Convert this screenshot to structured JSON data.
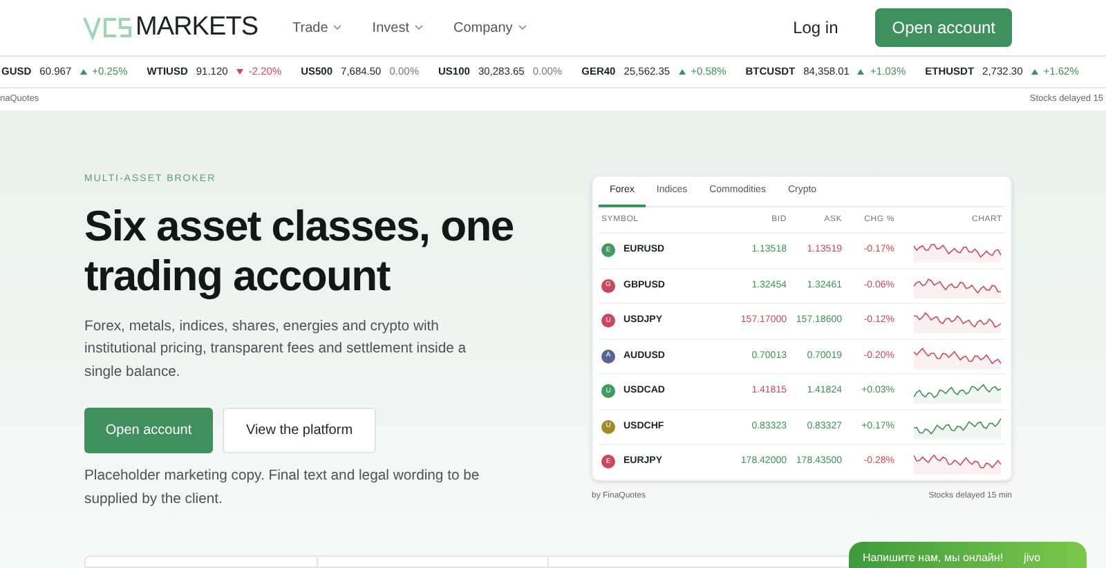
{
  "header": {
    "logo_text": "MARKETS",
    "nav": [
      {
        "label": "Trade"
      },
      {
        "label": "Invest"
      },
      {
        "label": "Company"
      }
    ],
    "login": "Log in",
    "cta": "Open account"
  },
  "ticker": [
    {
      "symbol": "GUSD",
      "price": "60.967",
      "change": "+0.25%",
      "rising": true,
      "falling": false
    },
    {
      "symbol": "WTIUSD",
      "price": "91.120",
      "change": "-2.20%",
      "rising": false,
      "falling": true
    },
    {
      "symbol": "US500",
      "price": "7,684.50",
      "change": "0.00%",
      "rising": false,
      "falling": false
    },
    {
      "symbol": "US100",
      "price": "30,283.65",
      "change": "0.00%",
      "rising": false,
      "falling": false
    },
    {
      "symbol": "GER40",
      "price": "25,562.35",
      "change": "+0.58%",
      "rising": true,
      "falling": false
    },
    {
      "symbol": "BTCUSDT",
      "price": "84,358.01",
      "change": "+1.03%",
      "rising": true,
      "falling": false
    },
    {
      "symbol": "ETHUSDT",
      "price": "2,732.30",
      "change": "+1.62%",
      "rising": true,
      "falling": false
    }
  ],
  "ticker_source": "naQuotes",
  "ticker_delay": "Stocks delayed 15",
  "hero": {
    "eyebrow": "MULTI-ASSET BROKER",
    "title": "Six asset classes, one trading account",
    "body": "Forex, metals, indices, shares, energies and crypto with institutional pricing, transparent fees and settlement inside a single balance.",
    "primary_button": "Open account",
    "secondary_button": "View the platform",
    "note": "Placeholder marketing copy. Final text and legal wording to be supplied by the client."
  },
  "quotes": {
    "tabs": [
      {
        "label": "Forex",
        "selected": true
      },
      {
        "label": "Indices",
        "selected": false
      },
      {
        "label": "Commodities",
        "selected": false
      },
      {
        "label": "Crypto",
        "selected": false
      }
    ],
    "columns": [
      "SYMBOL",
      "BID",
      "ASK",
      "CHG %",
      "CHART"
    ],
    "rows": [
      {
        "letter": "E",
        "color": "#3f9a63",
        "symbol": "EURUSD",
        "bid": "1.13518",
        "bid_up": true,
        "ask": "1.13519",
        "ask_up": false,
        "change": "-0.17%",
        "rising": false
      },
      {
        "letter": "G",
        "color": "#c9485f",
        "symbol": "GBPUSD",
        "bid": "1.32454",
        "bid_up": true,
        "ask": "1.32461",
        "ask_up": true,
        "change": "-0.06%",
        "rising": false
      },
      {
        "letter": "U",
        "color": "#c9485f",
        "symbol": "USDJPY",
        "bid": "157.17000",
        "bid_up": false,
        "ask": "157.18600",
        "ask_up": true,
        "change": "-0.12%",
        "rising": false
      },
      {
        "letter": "A",
        "color": "#56648f",
        "symbol": "AUDUSD",
        "bid": "0.70013",
        "bid_up": true,
        "ask": "0.70019",
        "ask_up": true,
        "change": "-0.20%",
        "rising": false
      },
      {
        "letter": "U",
        "color": "#3f9a63",
        "symbol": "USDCAD",
        "bid": "1.41815",
        "bid_up": false,
        "ask": "1.41824",
        "ask_up": true,
        "change": "+0.03%",
        "rising": true
      },
      {
        "letter": "U",
        "color": "#a08a2c",
        "symbol": "USDCHF",
        "bid": "0.83323",
        "bid_up": true,
        "ask": "0.83327",
        "ask_up": true,
        "change": "+0.17%",
        "rising": true
      },
      {
        "letter": "E",
        "color": "#c9485f",
        "symbol": "EURJPY",
        "bid": "178.42000",
        "bid_up": true,
        "ask": "178.43500",
        "ask_up": true,
        "change": "-0.28%",
        "rising": false
      }
    ],
    "source": "by FinaQuotes",
    "delay": "Stocks delayed 15 min"
  },
  "chat": {
    "label": "Напишите нам, мы онлайн!",
    "brand": "jivo"
  }
}
